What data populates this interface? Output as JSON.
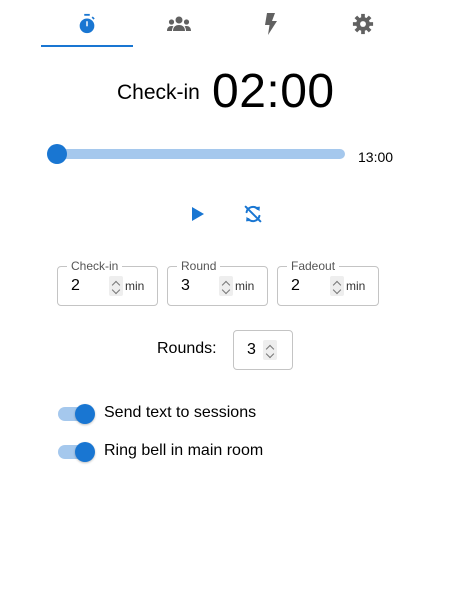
{
  "tabs": [
    {
      "icon": "timer-icon",
      "selected": true
    },
    {
      "icon": "groups-icon",
      "selected": false
    },
    {
      "icon": "flash-icon",
      "selected": false
    },
    {
      "icon": "settings-icon",
      "selected": false
    }
  ],
  "timer": {
    "phase_label": "Check-in",
    "time": "02:00"
  },
  "slider": {
    "position_fraction": 0,
    "end_label": "13:00"
  },
  "controls": {
    "play_icon": "play-icon",
    "reset_icon": "sync-disabled-icon"
  },
  "fields": {
    "checkin": {
      "label": "Check-in",
      "value": "2",
      "unit": "min"
    },
    "round": {
      "label": "Round",
      "value": "3",
      "unit": "min"
    },
    "fadeout": {
      "label": "Fadeout",
      "value": "2",
      "unit": "min"
    }
  },
  "rounds": {
    "label": "Rounds:",
    "value": "3"
  },
  "toggles": {
    "send_text": {
      "label": "Send text to sessions",
      "checked": true
    },
    "ring_bell": {
      "label": "Ring bell in main room",
      "checked": true
    }
  },
  "colors": {
    "primary": "#1976d2",
    "primary_light": "#a5c8ed",
    "icon_gray": "#616161"
  }
}
